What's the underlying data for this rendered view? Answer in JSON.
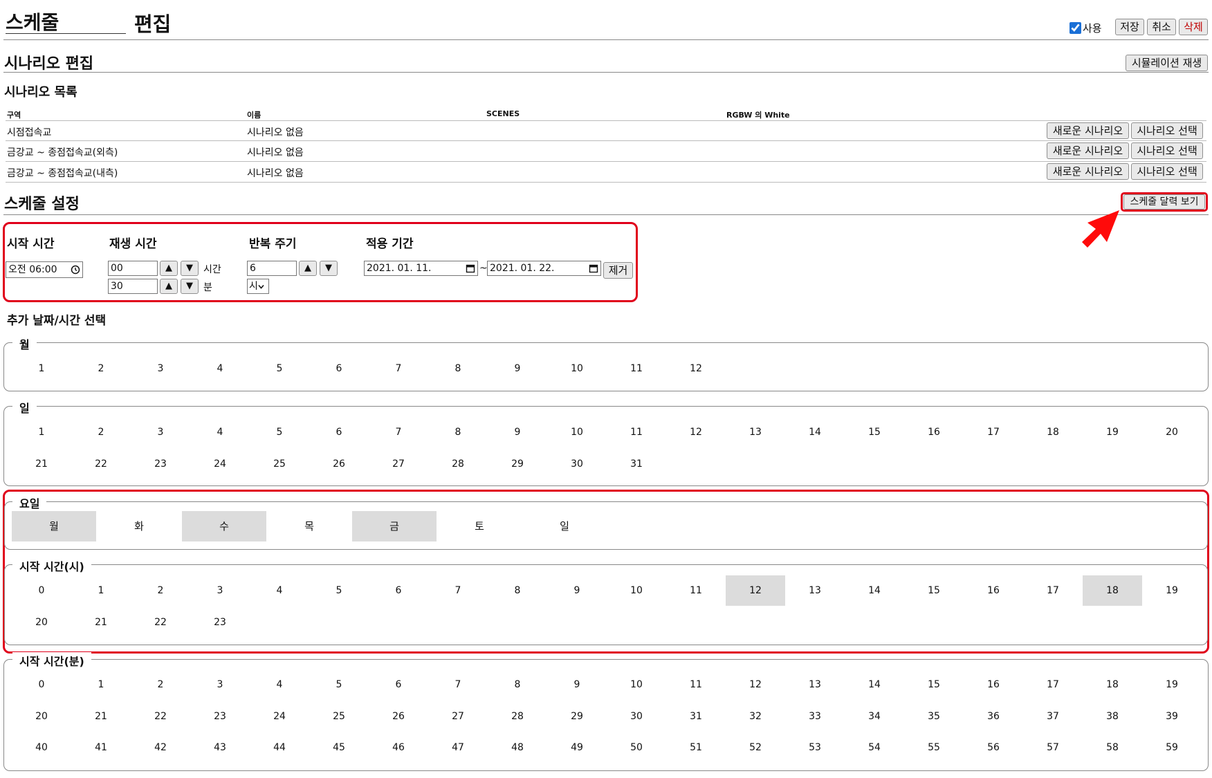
{
  "header": {
    "title_value": "스케줄",
    "title_suffix": "편집",
    "use_label": "사용",
    "use_checked": true,
    "save_label": "저장",
    "cancel_label": "취소",
    "delete_label": "삭제"
  },
  "scenario": {
    "heading": "시나리오 편집",
    "simulation_label": "시뮬레이션 재생",
    "list_heading": "시나리오 목록",
    "columns": [
      "구역",
      "이름",
      "SCENES",
      "RGBW 의 White"
    ],
    "rows": [
      {
        "zone": "시점접속교",
        "name": "시나리오 없음",
        "new_label": "새로운 시나리오",
        "select_label": "시나리오 선택"
      },
      {
        "zone": "금강교 ~ 종점접속교(외측)",
        "name": "시나리오 없음",
        "new_label": "새로운 시나리오",
        "select_label": "시나리오 선택"
      },
      {
        "zone": "금강교 ~ 종점접속교(내측)",
        "name": "시나리오 없음",
        "new_label": "새로운 시나리오",
        "select_label": "시나리오 선택"
      }
    ]
  },
  "schedule": {
    "heading": "스케줄 설정",
    "calendar_label": "스케줄 달력 보기",
    "start_time_label": "시작 시간",
    "start_time_value": "오전 06:00",
    "play_time_label": "재생 시간",
    "play_hours_value": "00",
    "hours_unit": "시간",
    "play_minutes_value": "30",
    "minutes_unit": "분",
    "repeat_label": "반복 주기",
    "repeat_value": "6",
    "repeat_unit": "시",
    "period_label": "적용 기간",
    "period_start": "2021. 01. 11.",
    "period_tilde": "~",
    "period_end": "2021. 01. 22.",
    "remove_label": "제거",
    "up_glyph": "▲",
    "down_glyph": "▼",
    "extra_heading": "추가 날짜/시간 선택"
  },
  "months": {
    "legend": "월",
    "items": [
      "1",
      "2",
      "3",
      "4",
      "5",
      "6",
      "7",
      "8",
      "9",
      "10",
      "11",
      "12"
    ]
  },
  "days": {
    "legend": "일",
    "items": [
      "1",
      "2",
      "3",
      "4",
      "5",
      "6",
      "7",
      "8",
      "9",
      "10",
      "11",
      "12",
      "13",
      "14",
      "15",
      "16",
      "17",
      "18",
      "19",
      "20",
      "21",
      "22",
      "23",
      "24",
      "25",
      "26",
      "27",
      "28",
      "29",
      "30",
      "31"
    ]
  },
  "weekdays": {
    "legend": "요일",
    "items": [
      {
        "label": "월",
        "selected": true
      },
      {
        "label": "화",
        "selected": false
      },
      {
        "label": "수",
        "selected": true
      },
      {
        "label": "목",
        "selected": false
      },
      {
        "label": "금",
        "selected": true
      },
      {
        "label": "토",
        "selected": false
      },
      {
        "label": "일",
        "selected": false
      }
    ]
  },
  "start_hours": {
    "legend": "시작 시간(시)",
    "items": [
      "0",
      "1",
      "2",
      "3",
      "4",
      "5",
      "6",
      "7",
      "8",
      "9",
      "10",
      "11",
      "12",
      "13",
      "14",
      "15",
      "16",
      "17",
      "18",
      "19",
      "20",
      "21",
      "22",
      "23"
    ],
    "selected": [
      "12",
      "18"
    ]
  },
  "start_minutes": {
    "legend": "시작 시간(분)",
    "count": 60
  },
  "colors": {
    "highlight_red": "#e0001b",
    "selected_gray": "#dcdcdc",
    "delete_red": "#c00000"
  },
  "icons": {
    "clock": "clock-icon",
    "calendar": "calendar-icon",
    "arrow": "red-arrow-icon"
  }
}
